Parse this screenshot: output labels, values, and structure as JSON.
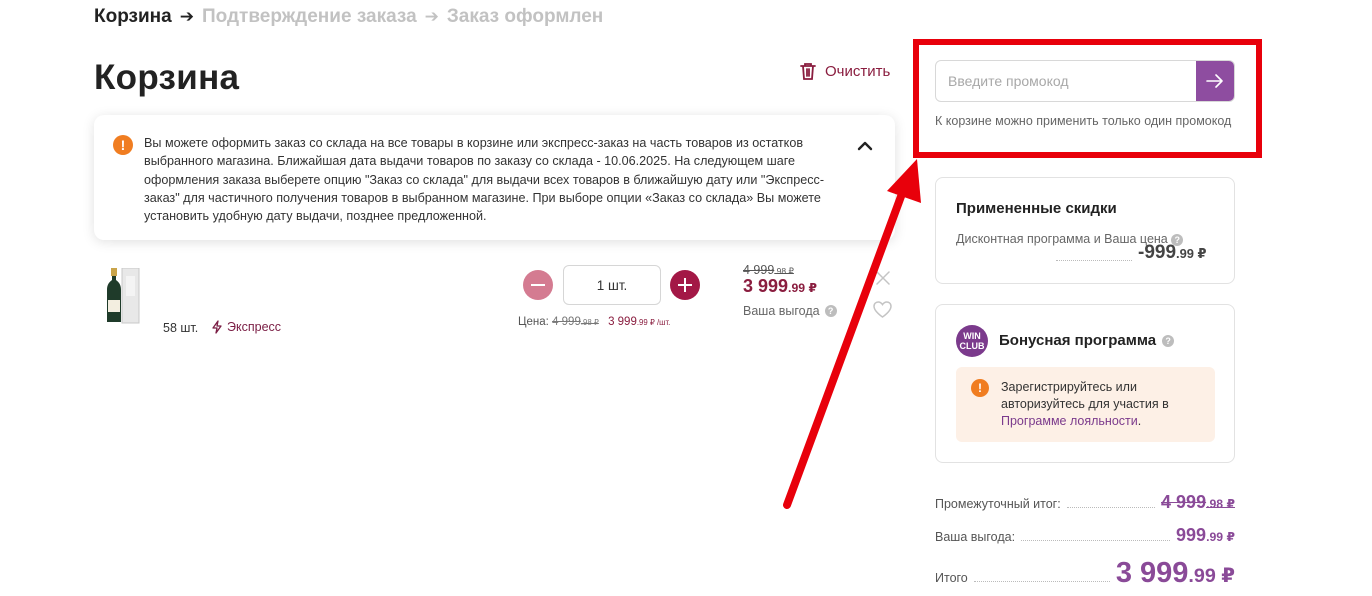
{
  "breadcrumb": {
    "step1": "Корзина",
    "step2": "Подтверждение заказа",
    "step3": "Заказ оформлен"
  },
  "page_title": "Корзина",
  "clear_label": "Очистить",
  "notice": {
    "text": "Вы можете оформить заказ со склада на все товары в корзине или экспресс-заказ на часть товаров из остатков выбранного магазина. Ближайшая дата выдачи товаров по заказу со склада - 10.06.2025.  На следующем шаге оформления заказа выберете опцию \"Заказ со склада\" для выдачи всех товаров в ближайшую дату или \"Экспресс-заказ\" для частичного получения товаров в выбранном магазине.  При выборе опции «Заказ со склада» Вы можете установить удобную дату выдачи, позднее предложенной."
  },
  "product": {
    "stock": "58 шт.",
    "express": "Экспресс",
    "quantity": "1 шт.",
    "unit_price_label": "Цена:",
    "unit_old_main": "4 999",
    "unit_old_cents": ".98 ₽",
    "unit_new_main": "3 999",
    "unit_new_cents": ".99 ₽ /шт.",
    "old_main": "4 999",
    "old_cents": ".98 ₽",
    "new_main": "3 999",
    "new_cents": ".99 ₽",
    "savings_label": "Ваша выгода"
  },
  "promo": {
    "placeholder": "Введите промокод",
    "hint": "К корзине можно применить только один промокод"
  },
  "discounts": {
    "title": "Примененные скидки",
    "label": "Дисконтная программа и Ваша цена",
    "value_main": "-999",
    "value_cents": ".99 ₽"
  },
  "bonus": {
    "logo_line1": "WIN",
    "logo_line2": "CLUB",
    "title": "Бонусная программа",
    "note_text": "Зарегистрируйтесь или авторизуйтесь для участия в ",
    "note_link": "Программе лояльности",
    "note_end": "."
  },
  "totals": {
    "subtotal_label": "Промежуточный итог:",
    "subtotal_main": "4 999",
    "subtotal_cents": ".98 ₽",
    "savings_label": "Ваша выгода:",
    "savings_main": "999",
    "savings_cents": ".99 ₽",
    "total_label": "Итого",
    "total_main": "3 999",
    "total_cents": ".99 ₽"
  },
  "colors": {
    "brand": "#8a1d3f",
    "accent_purple": "#8e4da0",
    "highlight": "#e8000b",
    "warning": "#f07d21"
  }
}
